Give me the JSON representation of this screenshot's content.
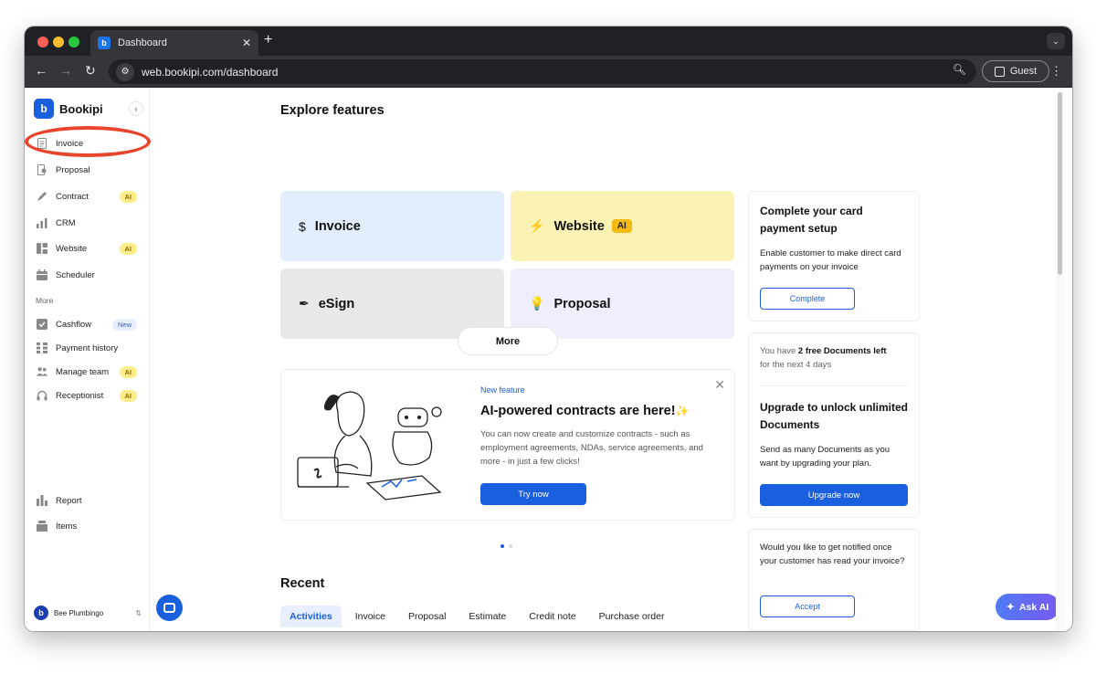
{
  "browser": {
    "tab_title": "Dashboard",
    "tab_close": "✕",
    "new_tab": "+",
    "url": "web.bookipi.com/dashboard",
    "profile_label": "Guest"
  },
  "sidebar": {
    "brand": "Bookipi",
    "items": [
      {
        "label": "Invoice",
        "icon": "document-icon"
      },
      {
        "label": "Proposal",
        "icon": "proposal-icon"
      },
      {
        "label": "Contract",
        "icon": "pen-icon",
        "badge": "AI"
      },
      {
        "label": "CRM",
        "icon": "bars-icon"
      },
      {
        "label": "Website",
        "icon": "layout-icon",
        "badge": "AI"
      },
      {
        "label": "Scheduler",
        "icon": "calendar-icon"
      }
    ],
    "more_label": "More",
    "more_items": [
      {
        "label": "Cashflow",
        "icon": "check-square-icon",
        "badge": "New"
      },
      {
        "label": "Payment history",
        "icon": "grid-icon"
      },
      {
        "label": "Manage team",
        "icon": "team-icon",
        "badge": "AI"
      },
      {
        "label": "Receptionist",
        "icon": "headphones-icon",
        "badge": "AI"
      }
    ],
    "bottom_items": [
      {
        "label": "Report",
        "icon": "chart-icon"
      },
      {
        "label": "Items",
        "icon": "box-icon"
      }
    ],
    "user_name": "Bee Plumbingo"
  },
  "main": {
    "explore_title": "Explore features",
    "features": [
      {
        "label": "Invoice",
        "icon": "$"
      },
      {
        "label": "Website",
        "icon": "⚡",
        "badge": "AI"
      },
      {
        "label": "eSign",
        "icon": "✒"
      },
      {
        "label": "Proposal",
        "icon": "💡"
      }
    ],
    "more_button": "More",
    "promo": {
      "tag": "New feature",
      "title": "AI-powered contracts are here!",
      "description": "You can now create and customize contracts - such as employment agreements, NDAs, service agreements, and more - in just a few clicks!",
      "button": "Try now"
    },
    "recent_title": "Recent",
    "recent_tabs": [
      "Activities",
      "Invoice",
      "Proposal",
      "Estimate",
      "Credit note",
      "Purchase order"
    ]
  },
  "side_cards": {
    "card_setup": {
      "title": "Complete your card payment setup",
      "text": "Enable customer to make direct card payments on your invoice",
      "button": "Complete"
    },
    "card_upgrade": {
      "docs_prefix": "You have ",
      "docs_count": "2 free Documents left",
      "docs_suffix": "for the next 4 days",
      "title": "Upgrade to unlock unlimited Documents",
      "text": "Send as many Documents as you want by upgrading your plan.",
      "button": "Upgrade now"
    },
    "card_notify": {
      "text": "Would you like to get notified once your customer has read your invoice?",
      "button": "Accept"
    }
  },
  "ask_ai": "Ask AI",
  "colors": {
    "accent": "#1a5fde",
    "annotation": "#e8452c",
    "invoice_card": "#e3eefc",
    "website_card": "#faf3b4",
    "esign_card": "#e8e8ea",
    "proposal_card": "#eeeefc"
  }
}
